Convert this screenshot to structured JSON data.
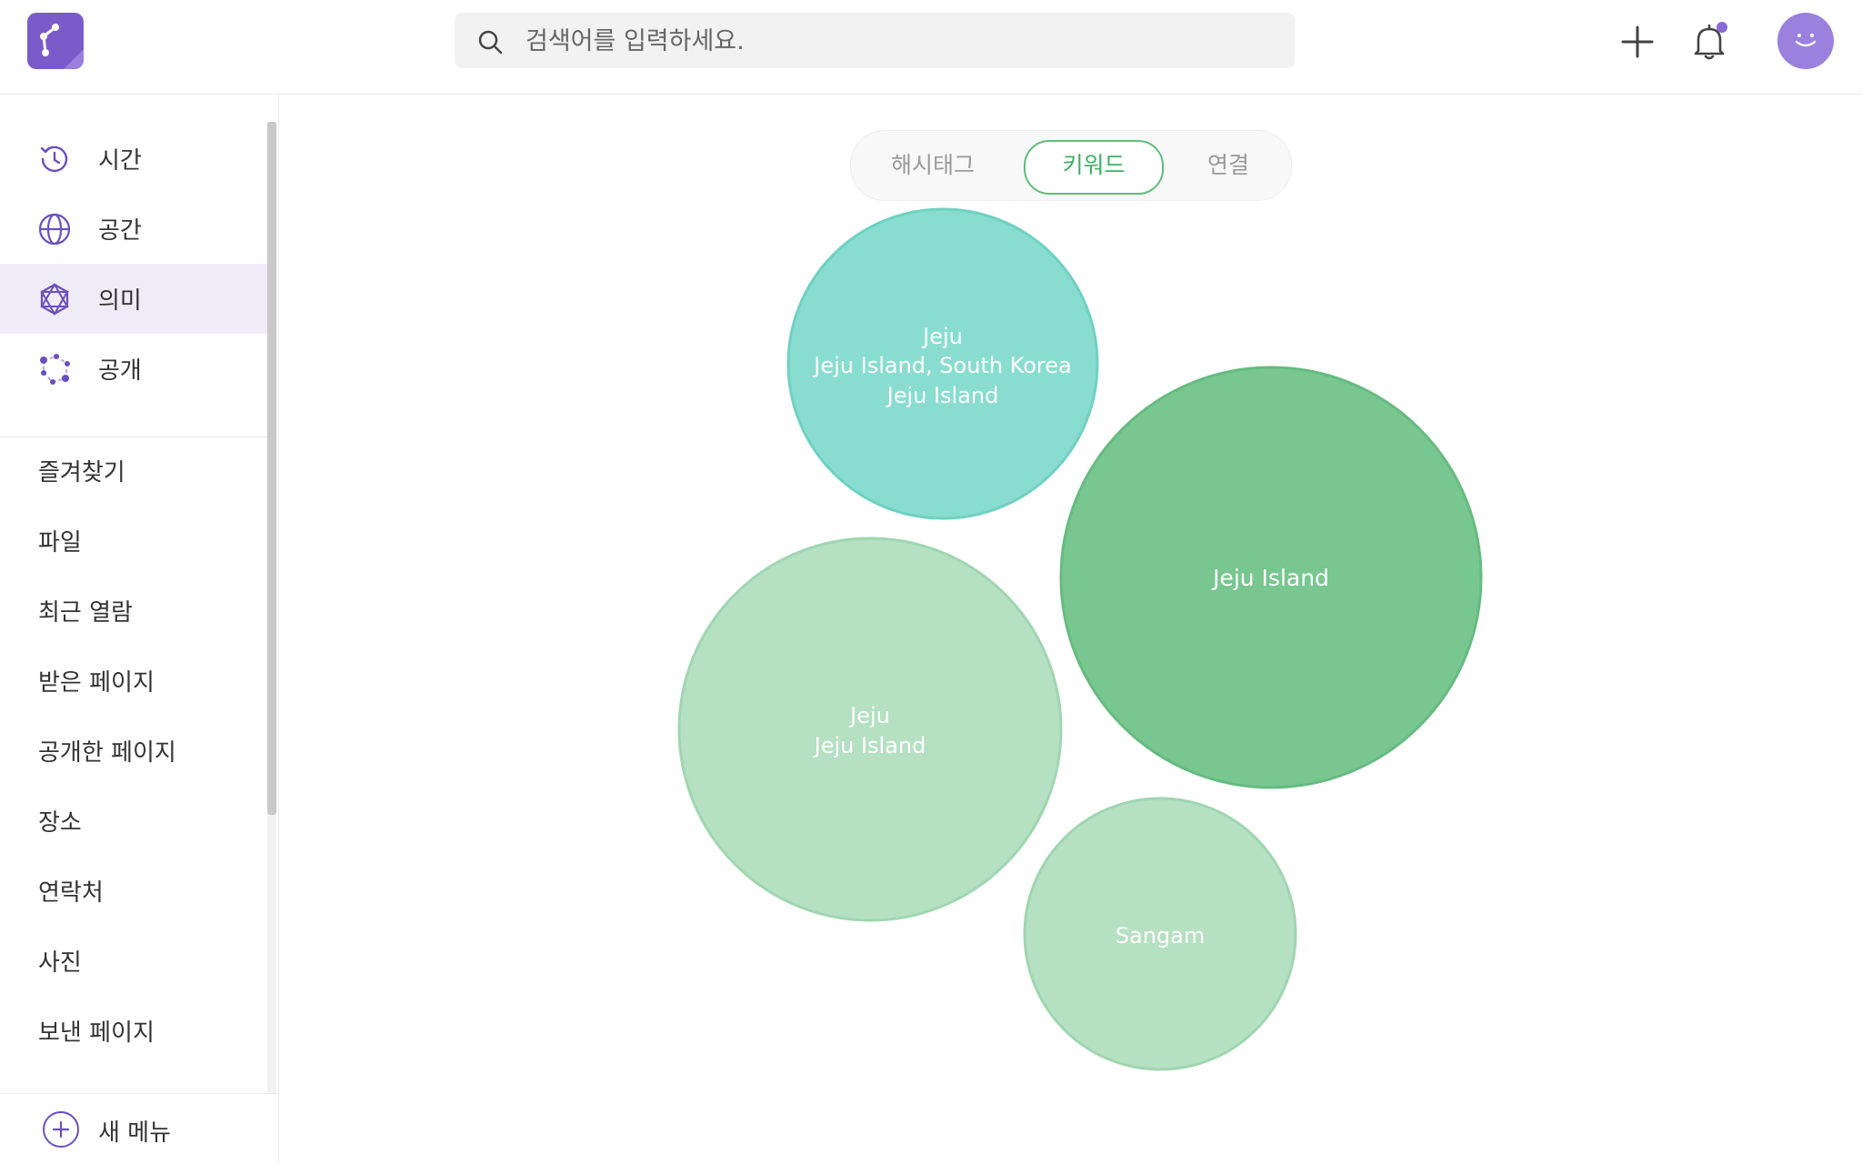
{
  "header": {
    "search_placeholder": "검색어를 입력하세요."
  },
  "sidebar": {
    "nav": [
      {
        "label": "시간",
        "icon": "clock-history-icon"
      },
      {
        "label": "공간",
        "icon": "globe-icon"
      },
      {
        "label": "의미",
        "icon": "hexagon-network-icon",
        "active": true
      },
      {
        "label": "공개",
        "icon": "share-nodes-icon"
      }
    ],
    "items": [
      "즐겨찾기",
      "파일",
      "최근 열람",
      "받은 페이지",
      "공개한 페이지",
      "장소",
      "연락처",
      "사진",
      "보낸 페이지"
    ],
    "new_menu_label": "새 메뉴"
  },
  "tabs": [
    {
      "label": "해시태그",
      "active": false
    },
    {
      "label": "키워드",
      "active": true
    },
    {
      "label": "연결",
      "active": false
    }
  ],
  "colors": {
    "brand": "#7b5bc9",
    "accent_green": "#5cbf7c",
    "bubble_teal": "#88ddd0",
    "bubble_green": "#78c690",
    "bubble_light": "#b5e0c2"
  },
  "bubbles": [
    {
      "lines": [
        "Jeju",
        "Jeju Island, South Korea",
        "Jeju Island"
      ],
      "color": "teal"
    },
    {
      "lines": [
        "Jeju Island"
      ],
      "color": "green"
    },
    {
      "lines": [
        "Jeju",
        "Jeju Island"
      ],
      "color": "light"
    },
    {
      "lines": [
        "Sangam"
      ],
      "color": "light"
    }
  ]
}
